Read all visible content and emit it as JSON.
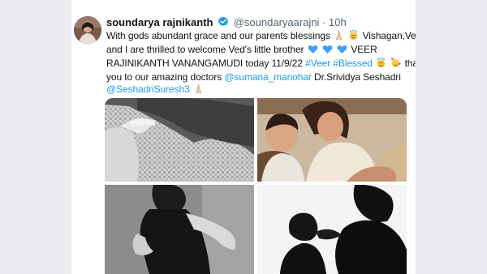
{
  "tweet": {
    "display_name": "soundarya rajnikanth",
    "handle": "@soundaryaarajni",
    "separator": "·",
    "time": "10h",
    "text": {
      "l1_a": "With gods abundant grace and our parents blessings",
      "l1_b": "Vishagan,Ved",
      "l2": "and I are thrilled to welcome Ved's little brother",
      "l2_b": "VEER",
      "l3_a": "RAJINIKANTH VANANGAMUDI today 11/9/22",
      "hashtag_veer": "#Veer",
      "hashtag_blessed": "#Blessed",
      "l3_b": "thank",
      "l4_a": "you to our amazing doctors",
      "mention_sumana": "@sumana_manohar",
      "l4_b": "Dr.Srividya Seshadri",
      "mention_seshadri": "@SeshadriSuresh3"
    }
  },
  "colors": {
    "link": "#1d9bf0",
    "verified": "#1d9bf0",
    "heart": "#3e9ff5",
    "text": "#0f1419",
    "muted": "#536471"
  },
  "icons": [
    "avatar",
    "verified-badge-icon",
    "folded-hands-emoji",
    "smiling-halo-emoji",
    "blue-heart-emoji",
    "hearts-face-emoji"
  ]
}
